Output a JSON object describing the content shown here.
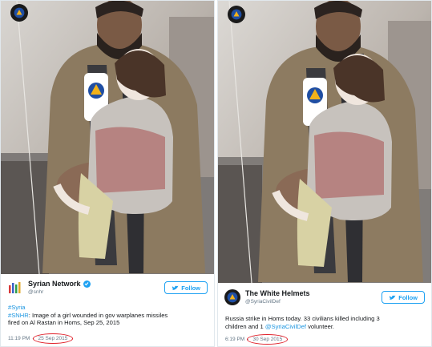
{
  "tweets": [
    {
      "account": {
        "display_name": "Syrian Network",
        "handle": "@snhr",
        "verified": true,
        "avatar_icon": "snhr-logo-icon"
      },
      "follow_label": "Follow",
      "text": {
        "hashtag_line": "#Syria",
        "line1_tag": "#SNHR",
        "line1_rest": ": Image of a girl wounded in gov warplanes missiles",
        "line2": "fired on Al Rastan in Homs, Sep 25, 2015"
      },
      "time": "11:19 PM",
      "date": "25 Sep 2015"
    },
    {
      "account": {
        "display_name": "The White Helmets",
        "handle": "@SyriaCivilDef",
        "verified": false,
        "avatar_icon": "white-helmets-logo-icon"
      },
      "follow_label": "Follow",
      "text": {
        "line1": "Russia strike in Homs today. 33 civilians killed including 3",
        "line2_pre": "children and 1 ",
        "line2_mention": "@SyriaCivilDef",
        "line2_post": " volunteer."
      },
      "time": "6:19 PM",
      "date": "30 Sep 2015"
    }
  ],
  "colors": {
    "accent": "#1da1f2",
    "link": "#1b95e0",
    "highlight_ring": "#e0202a",
    "meta_text": "#657786"
  }
}
